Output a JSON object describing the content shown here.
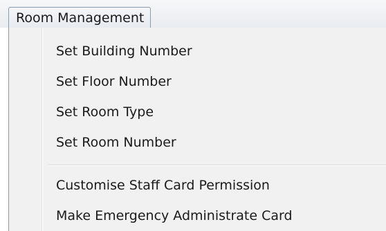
{
  "menubar": {
    "title": "Room Management"
  },
  "menu": {
    "group1": [
      {
        "label": "Set Building Number"
      },
      {
        "label": "Set Floor Number"
      },
      {
        "label": "Set Room Type"
      },
      {
        "label": "Set Room Number"
      }
    ],
    "group2": [
      {
        "label": "Customise Staff Card Permission"
      },
      {
        "label": "Make Emergency Administrate Card"
      }
    ]
  }
}
